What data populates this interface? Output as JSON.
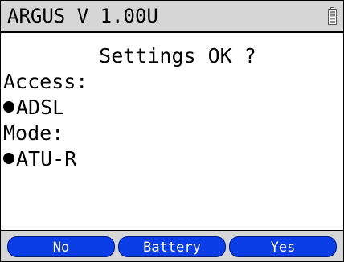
{
  "titlebar": {
    "title": "ARGUS V 1.00U",
    "battery_icon": "battery-icon"
  },
  "content": {
    "question": "Settings OK ?",
    "access_label": "Access:",
    "access_value": "ADSL",
    "mode_label": "Mode:",
    "mode_value": "ATU-R"
  },
  "softkeys": {
    "left": "No",
    "middle": "Battery",
    "right": "Yes"
  },
  "colors": {
    "bar_background": "#d6d6d6",
    "softkey": "#0a3de6",
    "softkey_text": "#ffffff"
  }
}
